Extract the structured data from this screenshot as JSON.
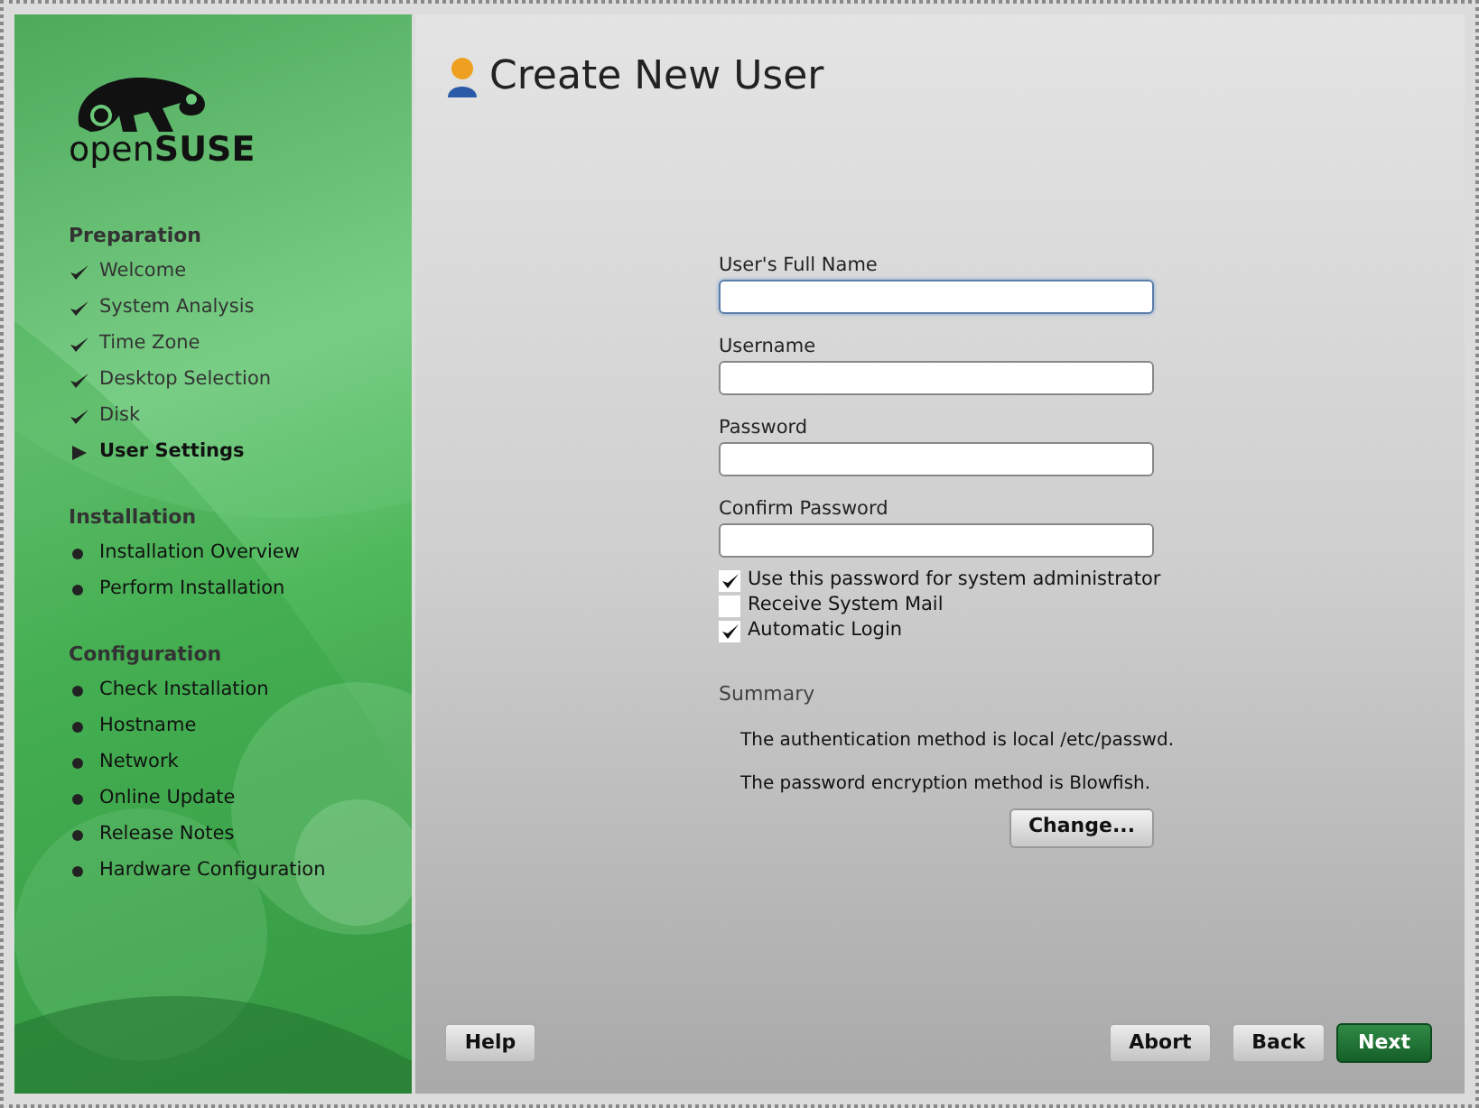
{
  "sidebar": {
    "logo": "open**SUSE**",
    "sections": [
      {
        "title": "Preparation",
        "items": [
          {
            "label": "Welcome",
            "kind": "done"
          },
          {
            "label": "System Analysis",
            "kind": "done"
          },
          {
            "label": "Time Zone",
            "kind": "done"
          },
          {
            "label": "Desktop Selection",
            "kind": "done"
          },
          {
            "label": "Disk",
            "kind": "done"
          },
          {
            "label": "User Settings",
            "kind": "current"
          }
        ]
      },
      {
        "title": "Installation",
        "items": [
          {
            "label": "Installation Overview",
            "kind": "pending"
          },
          {
            "label": "Perform Installation",
            "kind": "pending"
          }
        ]
      },
      {
        "title": "Configuration",
        "items": [
          {
            "label": "Check Installation",
            "kind": "pending"
          },
          {
            "label": "Hostname",
            "kind": "pending"
          },
          {
            "label": "Network",
            "kind": "pending"
          },
          {
            "label": "Online Update",
            "kind": "pending"
          },
          {
            "label": "Release Notes",
            "kind": "pending"
          },
          {
            "label": "Hardware Configuration",
            "kind": "pending"
          }
        ]
      }
    ]
  },
  "title": "Create New User",
  "fields": [
    {
      "label": "User's Full Name",
      "focused": true
    },
    {
      "label": "Username",
      "focused": false
    },
    {
      "label": "Password",
      "focused": false
    },
    {
      "label": "Confirm Password",
      "focused": false
    }
  ],
  "checkboxes": [
    {
      "label": "Use this password for system administrator",
      "checked": true
    },
    {
      "label": "Receive System Mail",
      "checked": false
    },
    {
      "label": "Automatic Login",
      "checked": true
    }
  ],
  "summary": {
    "heading": "Summary",
    "lines": [
      "The authentication method is local /etc/passwd.",
      "The password encryption method is Blowfish."
    ],
    "button": "Change..."
  },
  "buttons": [
    {
      "label": "Help",
      "kind": "plain"
    },
    {
      "label": "Abort",
      "kind": "plain"
    },
    {
      "label": "Back",
      "kind": "plain"
    },
    {
      "label": "Next",
      "kind": "primary"
    }
  ]
}
